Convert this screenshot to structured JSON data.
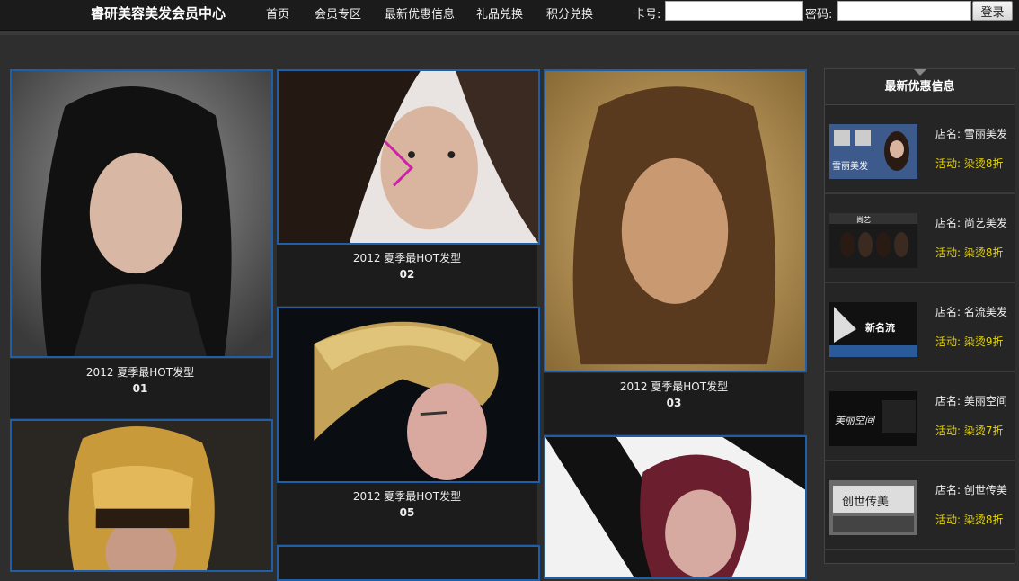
{
  "header": {
    "site_title": "睿研美容美发会员中心",
    "nav": [
      "首页",
      "会员专区",
      "最新优惠信息",
      "礼品兑换",
      "积分兑换"
    ],
    "card_label": "卡号:",
    "card_value": "",
    "password_label": "密码:",
    "password_value": "",
    "login_button": "登录"
  },
  "gallery": [
    {
      "title": "2012 夏季最HOT发型",
      "number": "01"
    },
    {
      "title": "2012 夏季最HOT发型",
      "number": "02"
    },
    {
      "title": "2012 夏季最HOT发型",
      "number": "03"
    },
    {
      "title": "2012 夏季最HOT发型",
      "number": "05"
    }
  ],
  "sidebar": {
    "title": "最新优惠信息",
    "items": [
      {
        "shop": "店名: 雪丽美发",
        "activity": "活动: 染烫8折",
        "thumb_text": "雪丽美发"
      },
      {
        "shop": "店名: 尚艺美发",
        "activity": "活动: 染烫8折",
        "thumb_text": "尚艺"
      },
      {
        "shop": "店名: 名流美发",
        "activity": "活动: 染烫9折",
        "thumb_text": "新名流"
      },
      {
        "shop": "店名: 美丽空间",
        "activity": "活动: 染烫7折",
        "thumb_text": "美丽空间"
      },
      {
        "shop": "店名: 创世传美",
        "activity": "活动: 染烫8折",
        "thumb_text": "创世传美"
      }
    ]
  },
  "colors": {
    "photo_border": "#1f5fa8",
    "activity_text": "#e6d400",
    "background": "#2e2e2e"
  }
}
